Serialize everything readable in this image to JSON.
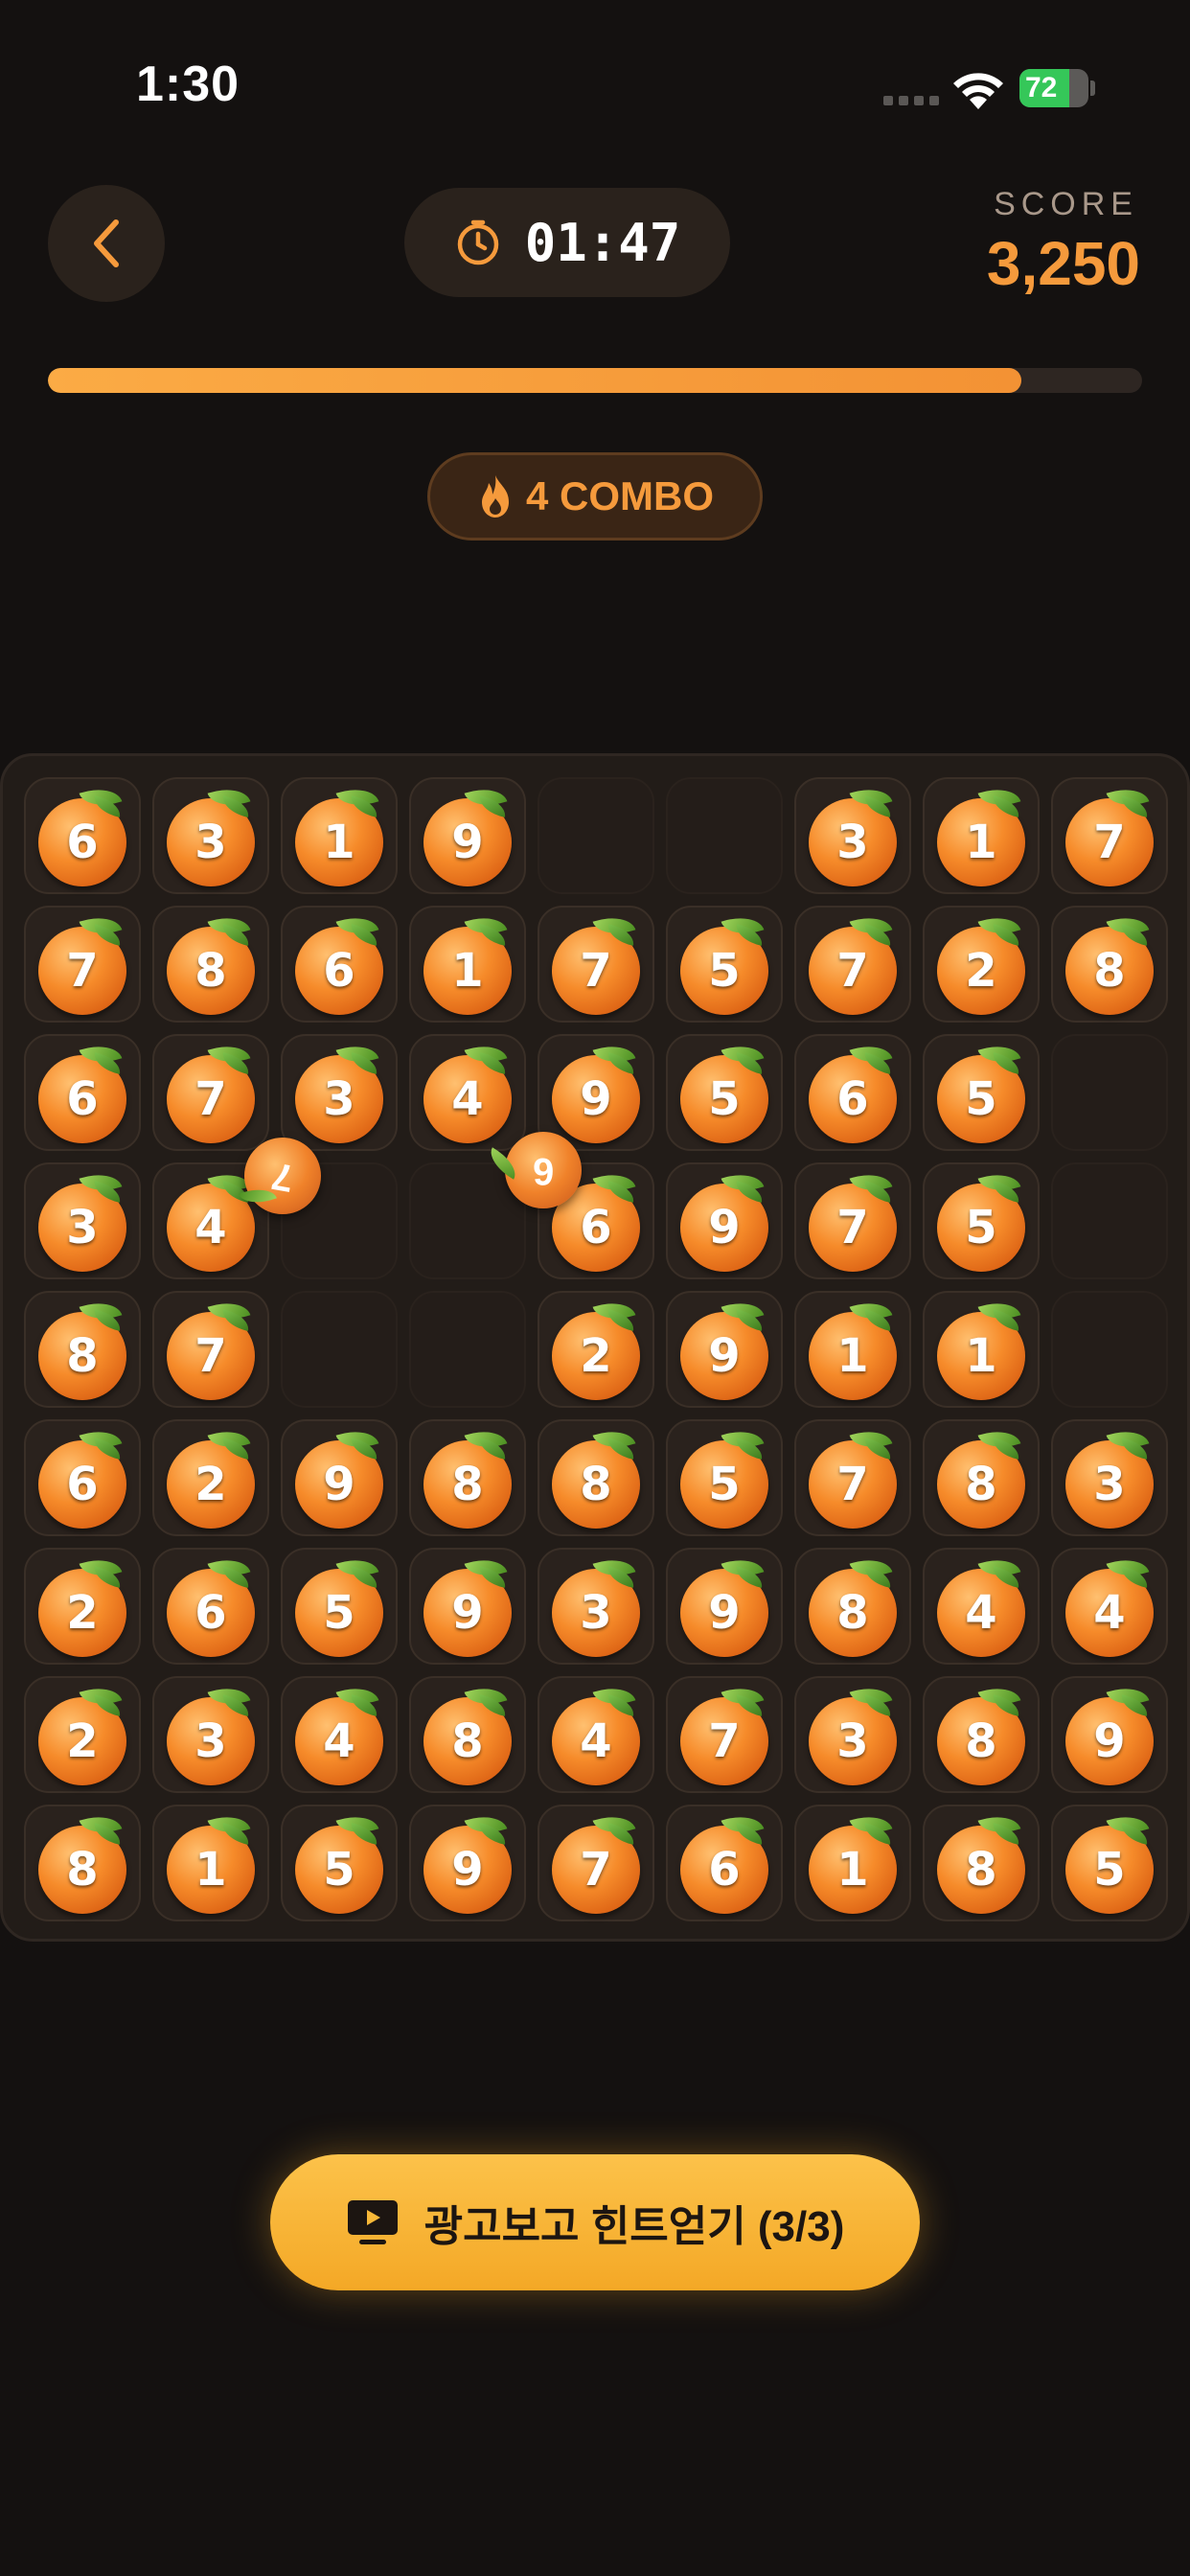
{
  "status_bar": {
    "time": "1:30",
    "battery": "72",
    "battery_level": 0.72
  },
  "header": {
    "back_icon": "chevron-left-icon",
    "timer_icon": "stopwatch-icon",
    "timer": "01:47",
    "score_label": "SCORE",
    "score": "3,250",
    "progress": 0.89
  },
  "combo": {
    "icon": "flame-icon",
    "label": "4 COMBO"
  },
  "board": {
    "columns": 9,
    "rows": 9,
    "grid": [
      [
        "6",
        "3",
        "1",
        "9",
        null,
        null,
        "3",
        "1",
        "7"
      ],
      [
        "7",
        "8",
        "6",
        "1",
        "7",
        "5",
        "7",
        "2",
        "8"
      ],
      [
        "6",
        "7",
        "3",
        "4",
        "9",
        "5",
        "6",
        "5",
        null
      ],
      [
        "3",
        "4",
        null,
        null,
        "6",
        "9",
        "7",
        "5",
        null
      ],
      [
        "8",
        "7",
        null,
        null,
        "2",
        "9",
        "1",
        "1",
        null
      ],
      [
        "6",
        "2",
        "9",
        "8",
        "8",
        "5",
        "7",
        "8",
        "3"
      ],
      [
        "2",
        "6",
        "5",
        "9",
        "3",
        "9",
        "8",
        "4",
        "4"
      ],
      [
        "2",
        "3",
        "4",
        "8",
        "4",
        "7",
        "3",
        "8",
        "9"
      ],
      [
        "8",
        "1",
        "5",
        "9",
        "7",
        "6",
        "1",
        "8",
        "5"
      ]
    ],
    "flying": [
      "7",
      "6"
    ]
  },
  "hint_button": {
    "icon": "play-video-icon",
    "label": "광고보고 힌트얻기 (3/3)"
  },
  "colors": {
    "background": "#141110",
    "accent": "#f59a3c",
    "button": "#f4a826"
  }
}
